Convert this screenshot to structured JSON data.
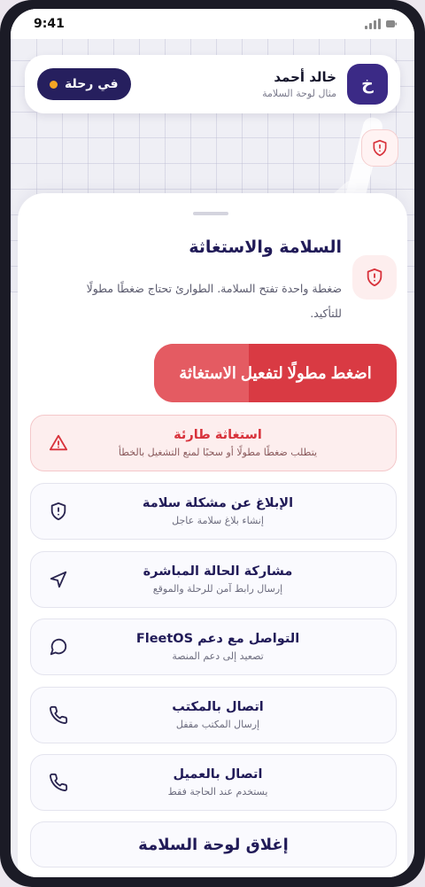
{
  "status_bar": {
    "time": "9:41"
  },
  "header": {
    "trip_label": "في رحلة",
    "driver_name": "خالد أحمد",
    "driver_subtitle": "مثال لوحة السلامة",
    "avatar_initial": "خ"
  },
  "sheet": {
    "title": "السلامة والاستغاثة",
    "description": "ضغطة واحدة تفتح السلامة. الطوارئ تحتاج ضغطًا مطولًا للتأكيد.",
    "emergency_button": {
      "label": "اضغط مطولًا لتفعيل الاستغاثة",
      "hold_progress": 0.39
    },
    "actions": [
      {
        "title": "استغاثة طارئة",
        "subtitle": "يتطلب ضغطًا مطولًا أو سحبًا لمنع التشغيل بالخطأ",
        "icon": "warning-icon"
      },
      {
        "title": "الإبلاغ عن مشكلة سلامة",
        "subtitle": "إنشاء بلاغ سلامة عاجل",
        "icon": "shield-icon"
      },
      {
        "title": "مشاركة الحالة المباشرة",
        "subtitle": "إرسال رابط آمن للرحلة والموقع",
        "icon": "navigation-icon"
      },
      {
        "title": "التواصل مع دعم FleetOS",
        "subtitle": "تصعيد إلى دعم المنصة",
        "icon": "chat-icon"
      },
      {
        "title": "اتصال بالمكتب",
        "subtitle": "إرسال المكتب مقفل",
        "icon": "phone-icon"
      },
      {
        "title": "اتصال بالعميل",
        "subtitle": "يستخدم عند الحاجة فقط",
        "icon": "phone-icon"
      }
    ],
    "close_label": "إغلاق لوحة السلامة"
  },
  "colors": {
    "primary": "#261f5e",
    "danger": "#d93a43",
    "danger_light": "#fdeeee",
    "accent_dot": "#f6a623"
  }
}
